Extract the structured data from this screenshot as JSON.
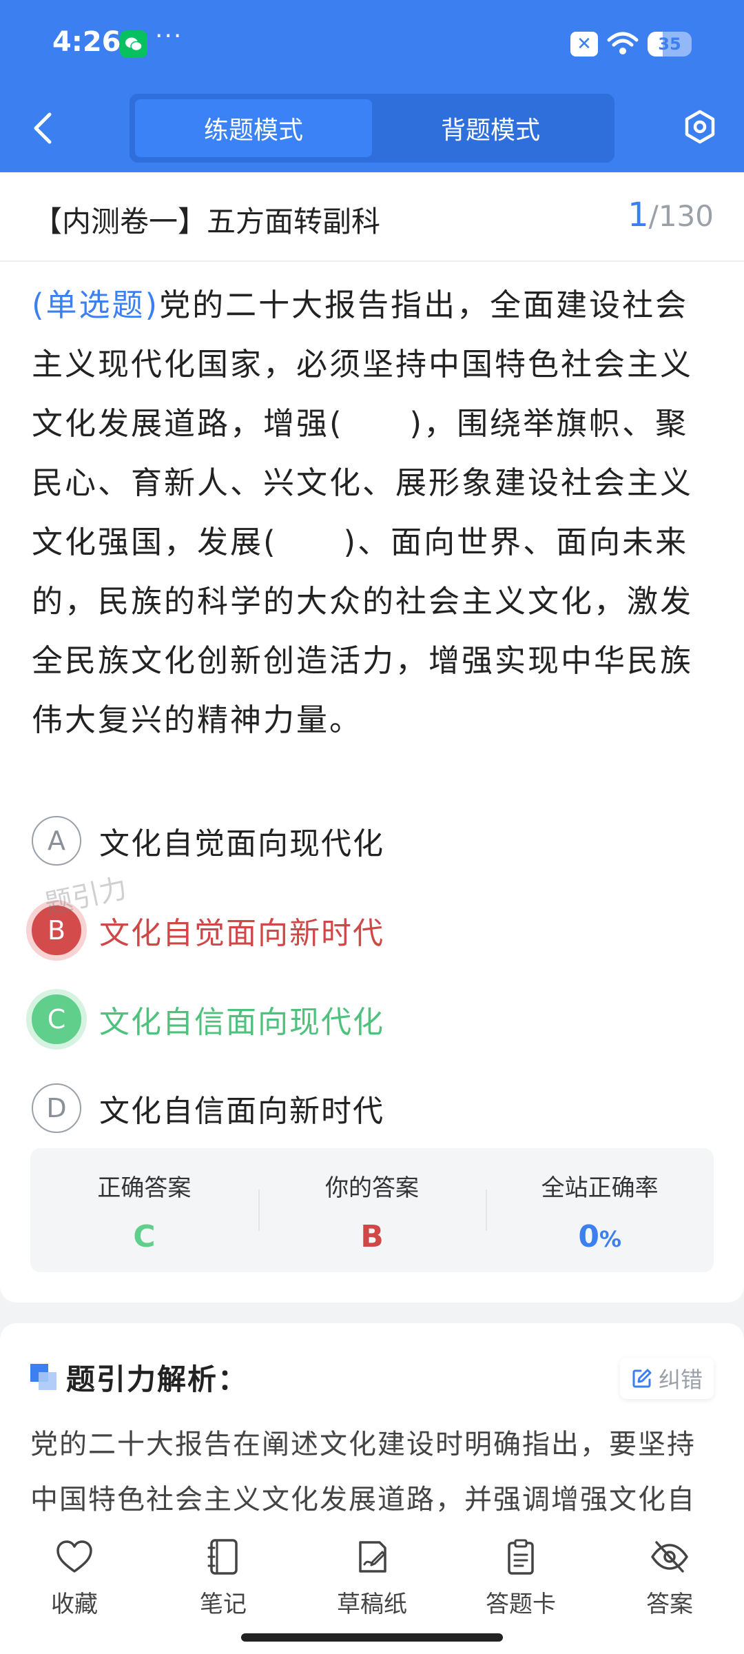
{
  "status_bar": {
    "time": "4:26",
    "more": "···",
    "battery_level": "35"
  },
  "nav": {
    "modes": [
      "练题模式",
      "背题模式"
    ],
    "active_mode": 0
  },
  "paper": {
    "title": "【内测卷一】五方面转副科",
    "current": "1",
    "total": "/130"
  },
  "question": {
    "type": "(单选题)",
    "text": "党的二十大报告指出，全面建设社会主义现代化国家，必须坚持中国特色社会主义文化发展道路，增强(　　)，围绕举旗帜、聚民心、育新人、兴文化、展形象建设社会主义文化强国，发展(　　)、面向世界、面向未来的，民族的科学的大众的社会主义文化，激发全民族文化创新创造活力，增强实现中华民族伟大复兴的精神力量。",
    "options": [
      {
        "letter": "A",
        "text": "文化自觉面向现代化",
        "state": "normal"
      },
      {
        "letter": "B",
        "text": "文化自觉面向新时代",
        "state": "wrong"
      },
      {
        "letter": "C",
        "text": "文化自信面向现代化",
        "state": "right"
      },
      {
        "letter": "D",
        "text": "文化自信面向新时代",
        "state": "normal"
      }
    ],
    "watermark": "题引力"
  },
  "result": {
    "correct_label": "正确答案",
    "correct_value": "C",
    "yours_label": "你的答案",
    "yours_value": "B",
    "rate_label": "全站正确率",
    "rate_value": "0",
    "rate_unit": "%"
  },
  "analysis": {
    "title": "题引力解析：",
    "correction": "纠错",
    "text": "党的二十大报告在阐述文化建设时明确指出，要坚持中国特色社会主义文化发展道路，并强调增强文化自"
  },
  "bottom_nav": {
    "favorite": "收藏",
    "notes": "笔记",
    "draft": "草稿纸",
    "answer_card": "答题卡",
    "answer": "答案"
  },
  "colors": {
    "primary": "#3b7ff0",
    "wrong": "#cf4747",
    "right": "#5fcf8b"
  }
}
